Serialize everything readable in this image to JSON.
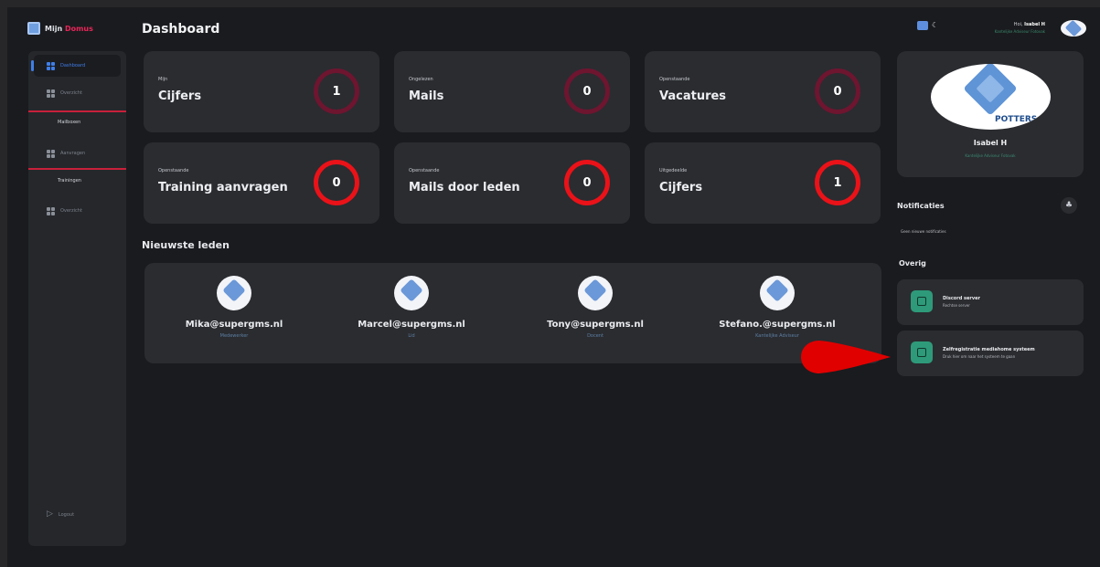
{
  "app": {
    "brand_prefix": "Mijn ",
    "brand_accent": "Domus"
  },
  "header": {
    "title": "Dashboard",
    "greeting_prefix": "Hoi, ",
    "user_name": "Isabel H",
    "user_role": "Kantelijke Adviseur Fotovak"
  },
  "sidebar": {
    "items": [
      {
        "label": "Dashboard"
      },
      {
        "label": "Overzicht"
      },
      {
        "label": "Aanvragen"
      },
      {
        "label": "Overzicht"
      }
    ],
    "section_mailbox": "Mailboxen",
    "section_trainings": "Trainingen",
    "logout": "Logout"
  },
  "stats": [
    {
      "small": "Mijn",
      "big": "Cijfers",
      "value": "1"
    },
    {
      "small": "Ongelezen",
      "big": "Mails",
      "value": "0"
    },
    {
      "small": "Openstaande",
      "big": "Vacatures",
      "value": "0"
    },
    {
      "small": "Openstaande",
      "big": "Training aanvragen",
      "value": "0"
    },
    {
      "small": "Openstaande",
      "big": "Mails door leden",
      "value": "0"
    },
    {
      "small": "Uitgedeelde",
      "big": "Cijfers",
      "value": "1"
    }
  ],
  "members": {
    "title": "Nieuwste leden",
    "list": [
      {
        "email": "Mika@supergms.nl",
        "role": "Medewerker"
      },
      {
        "email": "Marcel@supergms.nl",
        "role": "Lid"
      },
      {
        "email": "Tony@supergms.nl",
        "role": "Docent"
      },
      {
        "email": "Stefano.@supergms.nl",
        "role": "Kantelijke Adviseur"
      }
    ]
  },
  "profile": {
    "name": "Isabel H",
    "subtitle": "Kantelijke Adviseur Fotovak",
    "logo_word": "POTTERS"
  },
  "notifications": {
    "title": "Notificaties",
    "empty": "Geen nieuwe notificaties"
  },
  "overig": {
    "title": "Overig",
    "links": [
      {
        "title": "Discord server",
        "desc": "Rechtse server"
      },
      {
        "title": "Zelfregistratie mediahome systeem",
        "desc": "Druk hier om naar het systeem te gaan"
      }
    ]
  },
  "colors": {
    "background": "#1a1b1e",
    "card": "#2a2c30",
    "accent_blue": "#3f7ee8",
    "ring_dark": "#6e1530",
    "ring_bright": "#ea1218",
    "accent_green": "#2e9a79",
    "pointer": "#e00000"
  }
}
